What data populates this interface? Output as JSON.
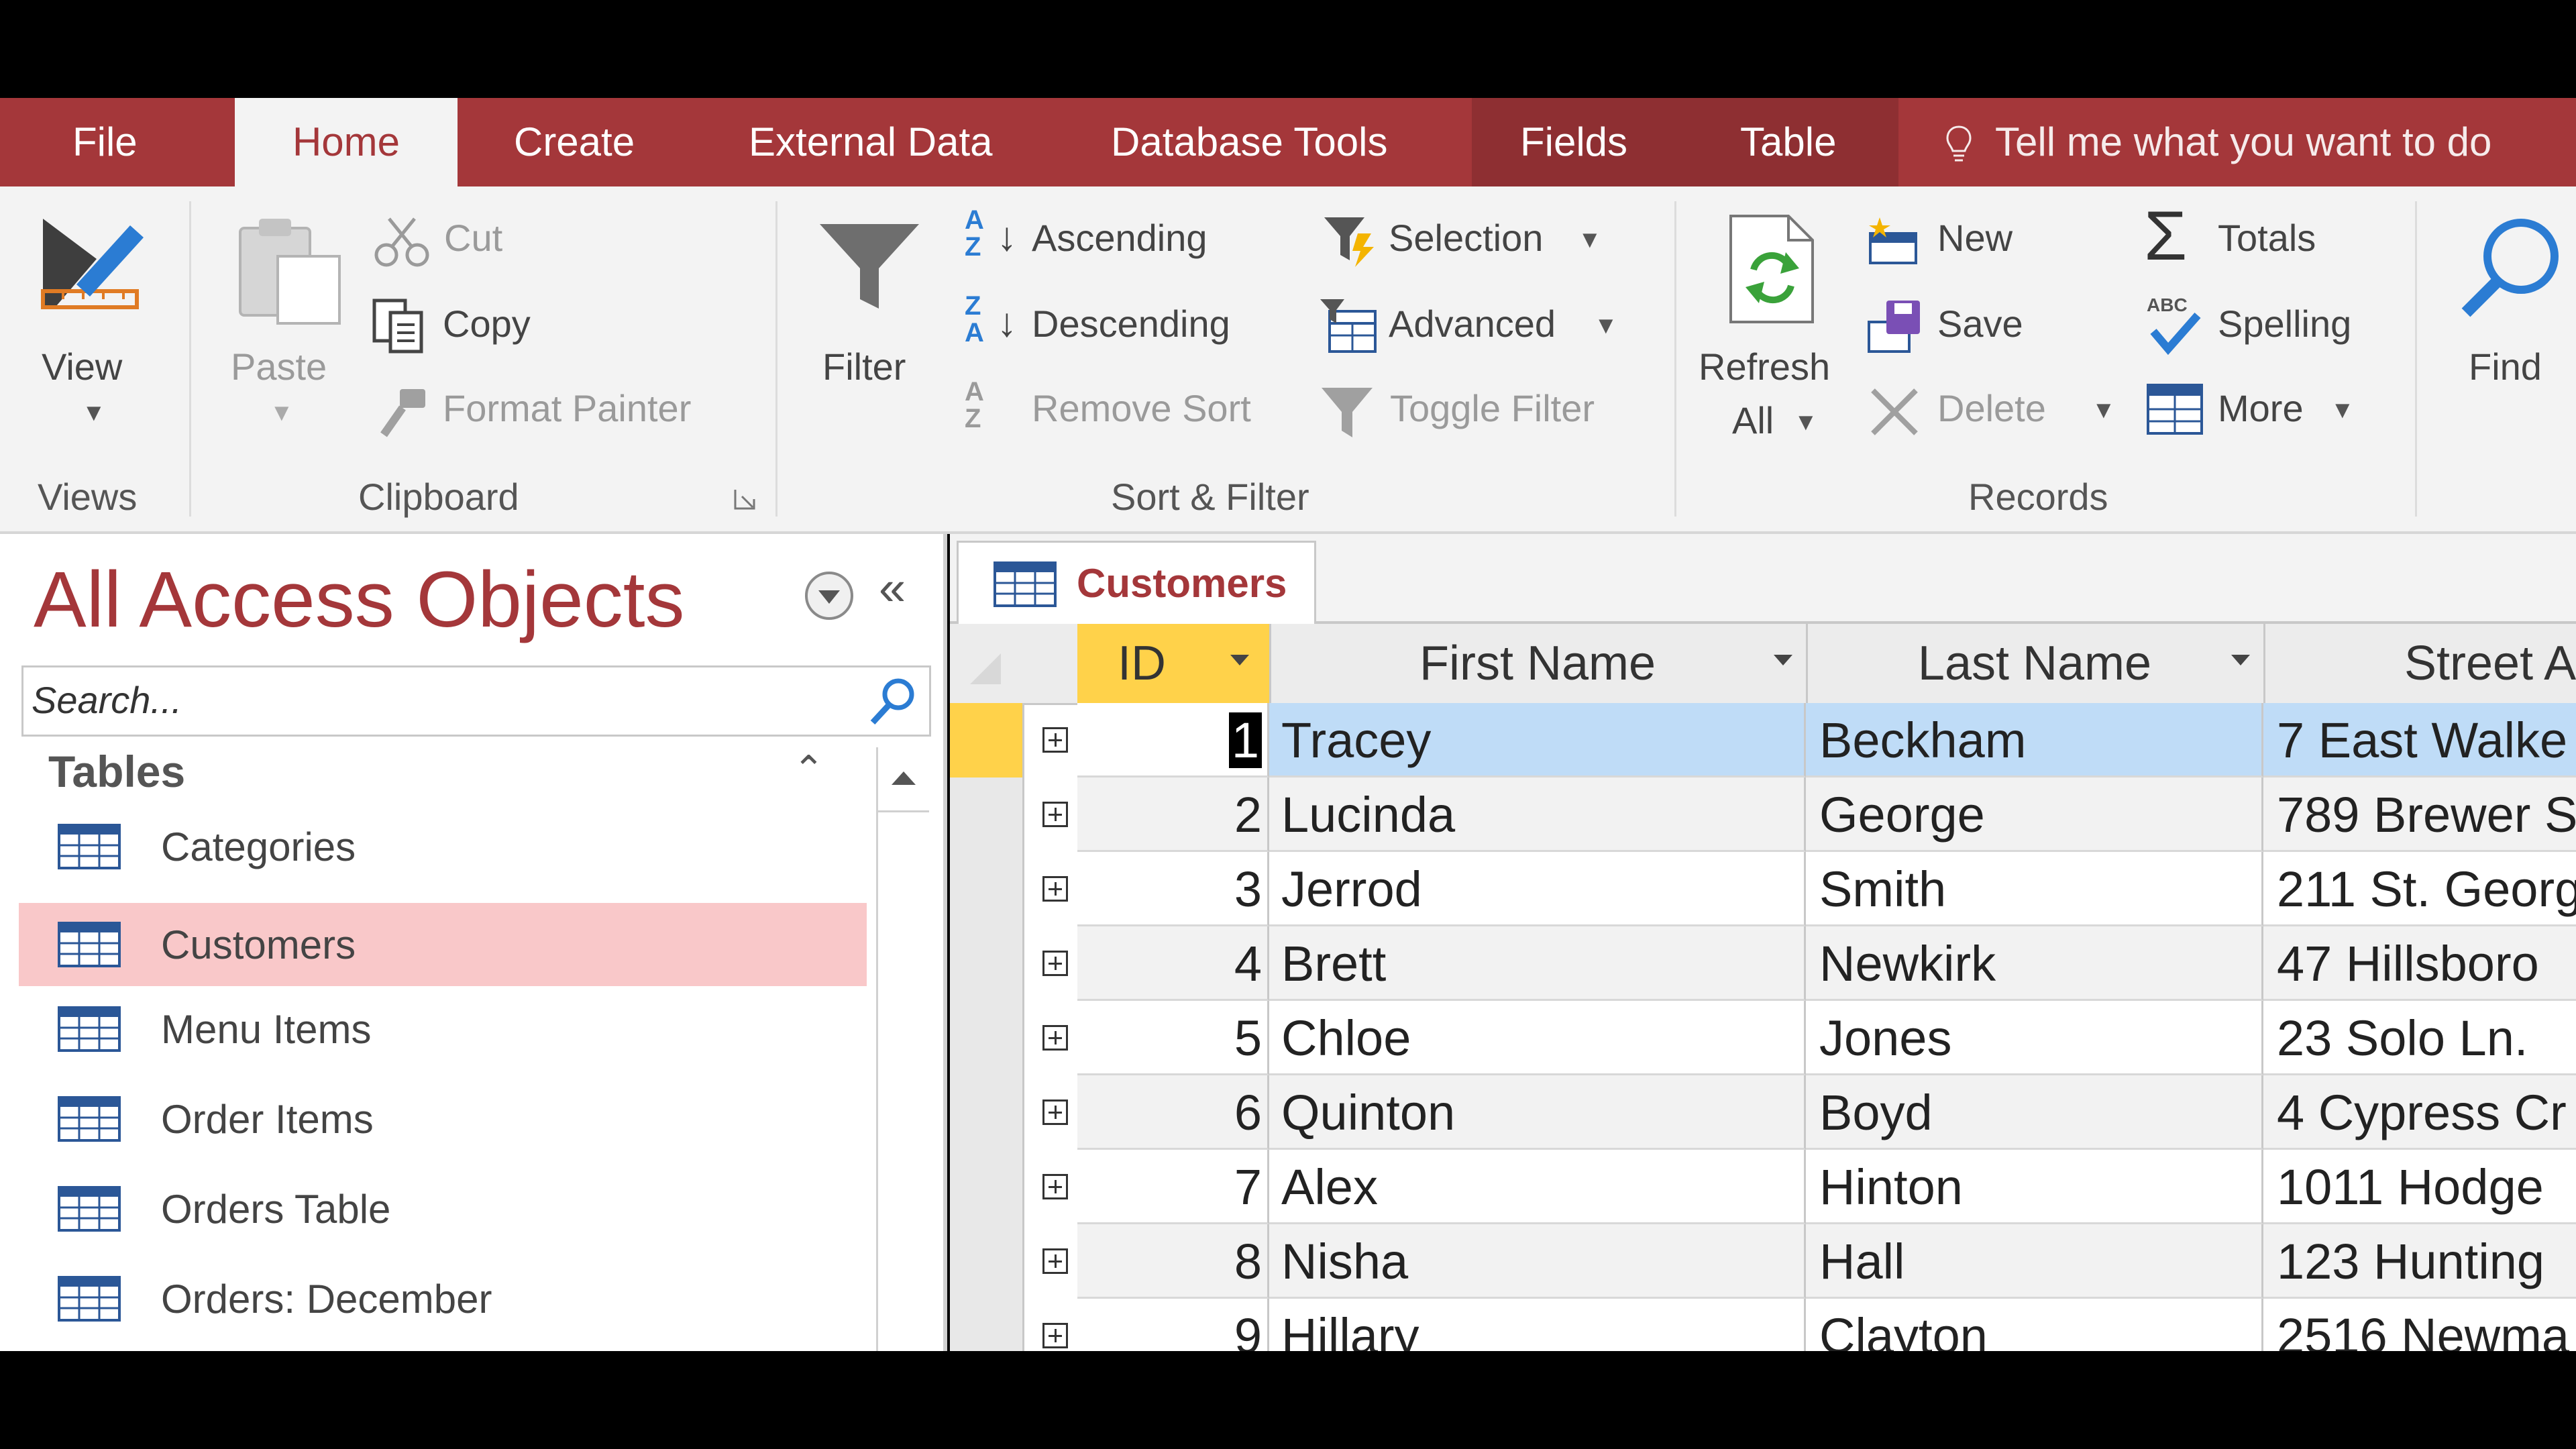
{
  "ribbon_tabs": {
    "file": "File",
    "home": "Home",
    "create": "Create",
    "external_data": "External Data",
    "database_tools": "Database Tools",
    "fields": "Fields",
    "table": "Table",
    "tell_me": "Tell me what you want to do"
  },
  "views": {
    "view": "View",
    "group": "Views"
  },
  "clipboard": {
    "paste": "Paste",
    "cut": "Cut",
    "copy": "Copy",
    "format_painter": "Format Painter",
    "group": "Clipboard"
  },
  "sort_filter": {
    "filter": "Filter",
    "ascending": "Ascending",
    "descending": "Descending",
    "remove_sort": "Remove Sort",
    "selection": "Selection",
    "advanced": "Advanced",
    "toggle_filter": "Toggle Filter",
    "group": "Sort & Filter"
  },
  "records": {
    "refresh": "Refresh",
    "refresh_all": "All",
    "new": "New",
    "save": "Save",
    "delete": "Delete",
    "totals": "Totals",
    "spelling": "Spelling",
    "more": "More",
    "group": "Records"
  },
  "find": {
    "find": "Find"
  },
  "nav_pane": {
    "title": "All Access Objects",
    "search_placeholder": "Search...",
    "group": "Tables",
    "items": [
      {
        "label": "Categories"
      },
      {
        "label": "Customers",
        "selected": true
      },
      {
        "label": "Menu Items"
      },
      {
        "label": "Order Items"
      },
      {
        "label": "Orders Table"
      },
      {
        "label": "Orders: December"
      }
    ]
  },
  "datasheet": {
    "tab_title": "Customers",
    "columns": {
      "id": "ID",
      "first_name": "First Name",
      "last_name": "Last Name",
      "street": "Street A"
    },
    "rows": [
      {
        "id": "1",
        "first": "Tracey",
        "last": "Beckham",
        "street": "7 East Walke"
      },
      {
        "id": "2",
        "first": "Lucinda",
        "last": "George",
        "street": "789 Brewer S"
      },
      {
        "id": "3",
        "first": "Jerrod",
        "last": "Smith",
        "street": "211 St. Georg"
      },
      {
        "id": "4",
        "first": "Brett",
        "last": "Newkirk",
        "street": "47 Hillsboro"
      },
      {
        "id": "5",
        "first": "Chloe",
        "last": "Jones",
        "street": "23 Solo Ln."
      },
      {
        "id": "6",
        "first": "Quinton",
        "last": "Boyd",
        "street": "4 Cypress Cr"
      },
      {
        "id": "7",
        "first": "Alex",
        "last": "Hinton",
        "street": "1011 Hodge"
      },
      {
        "id": "8",
        "first": "Nisha",
        "last": "Hall",
        "street": "123 Hunting"
      },
      {
        "id": "9",
        "first": "Hillary",
        "last": "Clayton",
        "street": "2516 Newma"
      }
    ]
  },
  "colors": {
    "accent": "#a4373a",
    "selection_highlight": "#f9c8c9",
    "current_row": "#bfdcf7",
    "id_header": "#ffd24a"
  }
}
